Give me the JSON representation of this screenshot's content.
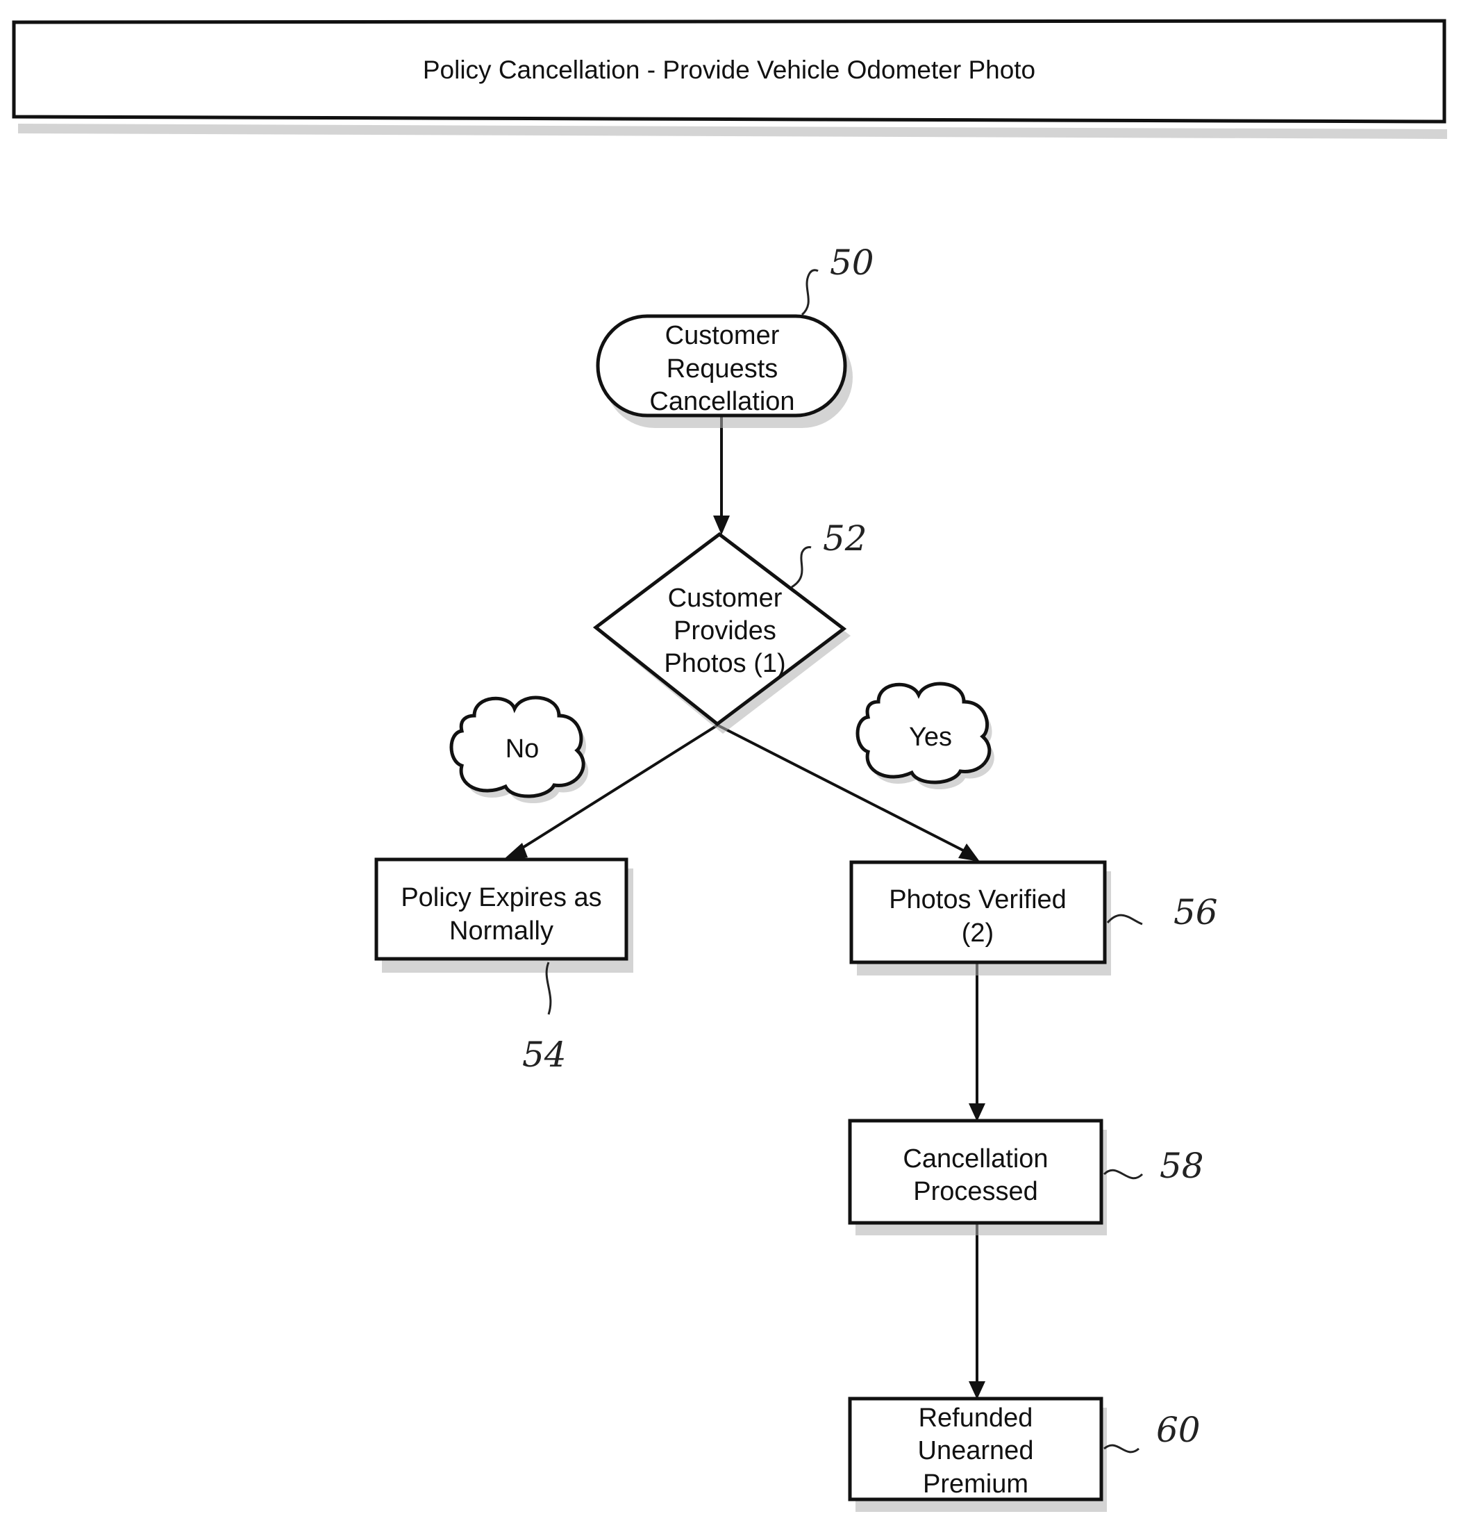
{
  "header": {
    "title": "Policy Cancellation  - Provide Vehicle Odometer Photo"
  },
  "nodes": {
    "start": {
      "lines": [
        "Customer",
        "Requests",
        "Cancellation"
      ],
      "ref": "50",
      "shape": "terminator"
    },
    "decision": {
      "lines": [
        "Customer",
        "Provides",
        "Photos (1)"
      ],
      "ref": "52",
      "shape": "diamond"
    },
    "expire": {
      "lines": [
        "Policy Expires as",
        "Normally"
      ],
      "ref": "54",
      "shape": "process"
    },
    "verify": {
      "lines": [
        "Photos Verified",
        "(2)"
      ],
      "ref": "56",
      "shape": "process"
    },
    "process": {
      "lines": [
        "Cancellation",
        "Processed"
      ],
      "ref": "58",
      "shape": "process"
    },
    "refund": {
      "lines": [
        "Refunded",
        "Unearned",
        "Premium"
      ],
      "ref": "60",
      "shape": "process"
    }
  },
  "branches": {
    "no": {
      "label": "No"
    },
    "yes": {
      "label": "Yes"
    }
  },
  "edges": [
    {
      "from": "start",
      "to": "decision"
    },
    {
      "from": "decision",
      "to": "expire",
      "label": "No"
    },
    {
      "from": "decision",
      "to": "verify",
      "label": "Yes"
    },
    {
      "from": "verify",
      "to": "process"
    },
    {
      "from": "process",
      "to": "refund"
    }
  ]
}
